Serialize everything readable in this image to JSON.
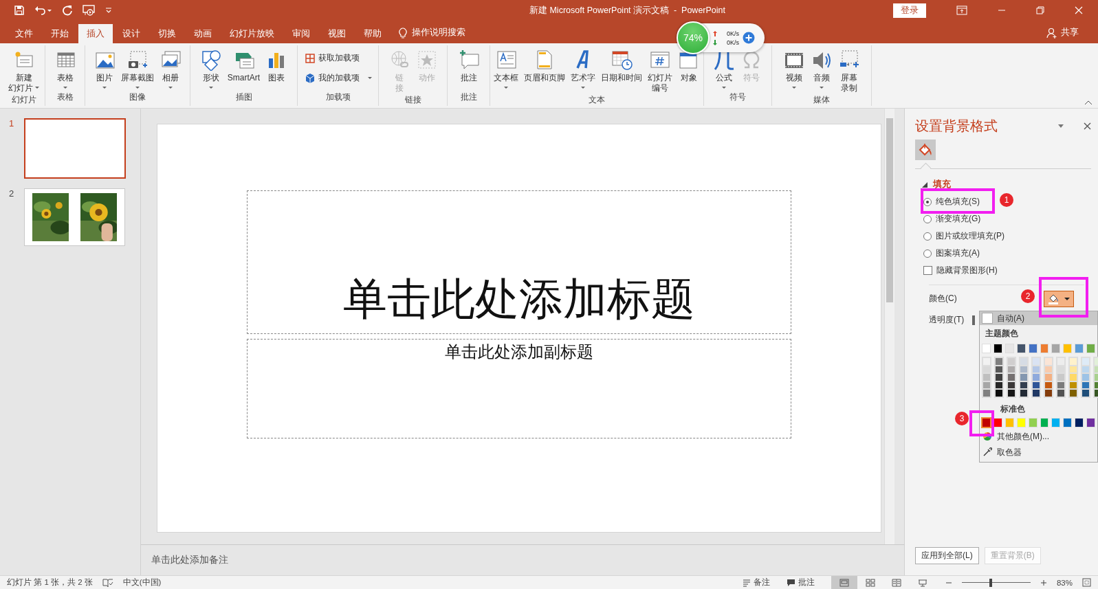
{
  "window": {
    "title": "新建 Microsoft PowerPoint 演示文稿  -  PowerPoint",
    "signin": "登录"
  },
  "tabs": [
    {
      "label": "文件",
      "selected": false
    },
    {
      "label": "开始",
      "selected": false
    },
    {
      "label": "插入",
      "selected": true
    },
    {
      "label": "设计",
      "selected": false
    },
    {
      "label": "切换",
      "selected": false
    },
    {
      "label": "动画",
      "selected": false
    },
    {
      "label": "幻灯片放映",
      "selected": false
    },
    {
      "label": "审阅",
      "selected": false
    },
    {
      "label": "视图",
      "selected": false
    },
    {
      "label": "帮助",
      "selected": false
    }
  ],
  "tell_me": "操作说明搜索",
  "share": "共享",
  "ribbon": {
    "groups": [
      {
        "label": "幻灯片",
        "items": [
          {
            "lines": [
              "新建",
              "幻灯片"
            ],
            "kind": "large",
            "dropdown": true,
            "disabled": false
          }
        ]
      },
      {
        "label": "表格",
        "items": [
          {
            "label": "表格",
            "kind": "large",
            "dropdown": true,
            "disabled": false
          }
        ]
      },
      {
        "label": "图像",
        "items": [
          {
            "label": "图片",
            "kind": "large",
            "dropdown": true,
            "disabled": false
          },
          {
            "label": "屏幕截图",
            "kind": "large",
            "dropdown": true,
            "disabled": false
          },
          {
            "label": "相册",
            "kind": "large",
            "dropdown": true,
            "disabled": false
          }
        ]
      },
      {
        "label": "插图",
        "items": [
          {
            "label": "形状",
            "kind": "large",
            "dropdown": true,
            "disabled": false
          },
          {
            "label": "SmartArt",
            "kind": "large",
            "dropdown": false,
            "disabled": false
          },
          {
            "label": "图表",
            "kind": "large",
            "dropdown": false,
            "disabled": false
          }
        ]
      },
      {
        "label": "加载项",
        "items": [
          {
            "label": "获取加载项",
            "kind": "small",
            "dropdown": false,
            "disabled": false
          },
          {
            "label": "我的加载项",
            "kind": "small",
            "dropdown": true,
            "disabled": false
          }
        ]
      },
      {
        "label": "链接",
        "items": [
          {
            "lines": [
              "链",
              "接"
            ],
            "kind": "large",
            "dropdown": false,
            "disabled": true
          },
          {
            "label": "动作",
            "kind": "large",
            "dropdown": false,
            "disabled": true
          }
        ]
      },
      {
        "label": "批注",
        "items": [
          {
            "label": "批注",
            "kind": "large",
            "dropdown": false,
            "disabled": false
          }
        ]
      },
      {
        "label": "文本",
        "items": [
          {
            "label": "文本框",
            "kind": "large",
            "dropdown": true,
            "disabled": false
          },
          {
            "label": "页眉和页脚",
            "kind": "large",
            "dropdown": false,
            "disabled": false
          },
          {
            "label": "艺术字",
            "kind": "large",
            "dropdown": true,
            "disabled": false
          },
          {
            "label": "日期和时间",
            "kind": "large",
            "dropdown": false,
            "disabled": false
          },
          {
            "lines": [
              "幻灯片",
              "编号"
            ],
            "kind": "large",
            "dropdown": false,
            "disabled": false
          },
          {
            "label": "对象",
            "kind": "large",
            "dropdown": false,
            "disabled": false
          }
        ]
      },
      {
        "label": "符号",
        "items": [
          {
            "label": "公式",
            "kind": "large",
            "dropdown": true,
            "disabled": false
          },
          {
            "label": "符号",
            "kind": "large",
            "dropdown": false,
            "disabled": true
          }
        ]
      },
      {
        "label": "媒体",
        "items": [
          {
            "label": "视频",
            "kind": "large",
            "dropdown": true,
            "disabled": false
          },
          {
            "label": "音频",
            "kind": "large",
            "dropdown": true,
            "disabled": false
          },
          {
            "lines": [
              "屏幕",
              "录制"
            ],
            "kind": "large",
            "dropdown": false,
            "disabled": false
          }
        ]
      }
    ]
  },
  "net_monitor": {
    "percent": "74%",
    "up": "0K/s",
    "down": "0K/s"
  },
  "slides": [
    {
      "number": "1",
      "selected": true
    },
    {
      "number": "2",
      "selected": false
    }
  ],
  "slide": {
    "title": "单击此处添加标题",
    "subtitle": "单击此处添加副标题"
  },
  "notes": "单击此处添加备注",
  "pane": {
    "title": "设置背景格式",
    "section": "填充",
    "expanded": true,
    "fill_options": [
      {
        "label": "纯色填充(S)",
        "selected": true
      },
      {
        "label": "渐变填充(G)",
        "selected": false
      },
      {
        "label": "图片或纹理填充(P)",
        "selected": false
      },
      {
        "label": "图案填充(A)",
        "selected": false
      }
    ],
    "hide_graphics": {
      "label": "隐藏背景图形(H)",
      "checked": false
    },
    "color_label": "颜色(C)",
    "color_button": {
      "color": "#f4b183"
    },
    "transparency_label": "透明度(T)",
    "buttons": [
      {
        "label": "应用到全部(L)",
        "disabled": false
      },
      {
        "label": "重置背景(B)",
        "disabled": true
      }
    ]
  },
  "color_menu": {
    "auto": "自动(A)",
    "theme_label": "主题颜色",
    "theme": [
      {
        "color": "#ffffff",
        "shades": [
          {
            "color": "#f2f2f2"
          },
          {
            "color": "#d9d9d9"
          },
          {
            "color": "#bfbfbf"
          },
          {
            "color": "#a6a6a6"
          },
          {
            "color": "#808080"
          }
        ]
      },
      {
        "color": "#000000",
        "shades": [
          {
            "color": "#808080"
          },
          {
            "color": "#595959"
          },
          {
            "color": "#404040"
          },
          {
            "color": "#262626"
          },
          {
            "color": "#0d0d0d"
          }
        ]
      },
      {
        "color": "#e7e6e6",
        "shades": [
          {
            "color": "#d0cece"
          },
          {
            "color": "#aeabab"
          },
          {
            "color": "#757070"
          },
          {
            "color": "#3b3838"
          },
          {
            "color": "#171616"
          }
        ]
      },
      {
        "color": "#44546a",
        "shades": [
          {
            "color": "#d6dce5"
          },
          {
            "color": "#adb9ca"
          },
          {
            "color": "#8497b0"
          },
          {
            "color": "#333f50"
          },
          {
            "color": "#222a35"
          }
        ]
      },
      {
        "color": "#4472c4",
        "shades": [
          {
            "color": "#dae3f3"
          },
          {
            "color": "#b4c7e7"
          },
          {
            "color": "#8faadc"
          },
          {
            "color": "#2f5597"
          },
          {
            "color": "#203864"
          }
        ]
      },
      {
        "color": "#ed7d31",
        "shades": [
          {
            "color": "#fbe5d6"
          },
          {
            "color": "#f8cbad"
          },
          {
            "color": "#f4b183"
          },
          {
            "color": "#c55a11"
          },
          {
            "color": "#843c0c"
          }
        ]
      },
      {
        "color": "#a5a5a5",
        "shades": [
          {
            "color": "#ededed"
          },
          {
            "color": "#dbdbdb"
          },
          {
            "color": "#c9c9c9"
          },
          {
            "color": "#7b7b7b"
          },
          {
            "color": "#525252"
          }
        ]
      },
      {
        "color": "#ffc000",
        "shades": [
          {
            "color": "#fff2cc"
          },
          {
            "color": "#ffe699"
          },
          {
            "color": "#ffd966"
          },
          {
            "color": "#bf9000"
          },
          {
            "color": "#7f6000"
          }
        ]
      },
      {
        "color": "#5b9bd5",
        "shades": [
          {
            "color": "#deebf7"
          },
          {
            "color": "#bdd7ee"
          },
          {
            "color": "#9dc3e6"
          },
          {
            "color": "#2e75b6"
          },
          {
            "color": "#1f4e79"
          }
        ]
      },
      {
        "color": "#70ad47",
        "shades": [
          {
            "color": "#e2f0d9"
          },
          {
            "color": "#c5e0b4"
          },
          {
            "color": "#a9d18e"
          },
          {
            "color": "#548235"
          },
          {
            "color": "#385723"
          }
        ]
      }
    ],
    "standard_label": "标准色",
    "standard": [
      {
        "color": "#c00000",
        "selected": true
      },
      {
        "color": "#ff0000",
        "selected": false
      },
      {
        "color": "#ffc000",
        "selected": false
      },
      {
        "color": "#ffff00",
        "selected": false
      },
      {
        "color": "#92d050",
        "selected": false
      },
      {
        "color": "#00b050",
        "selected": false
      },
      {
        "color": "#00b0f0",
        "selected": false
      },
      {
        "color": "#0070c0",
        "selected": false
      },
      {
        "color": "#002060",
        "selected": false
      },
      {
        "color": "#7030a0",
        "selected": false
      }
    ],
    "more": "其他颜色(M)...",
    "eyedropper": "取色器"
  },
  "annotations": [
    {
      "number": "1"
    },
    {
      "number": "2"
    },
    {
      "number": "3"
    }
  ],
  "status": {
    "slide_info": "幻灯片 第 1 张，共 2 张",
    "language": "中文(中国)",
    "notes": "备注",
    "comments": "批注",
    "views": [
      {
        "selected": true
      },
      {
        "selected": false
      },
      {
        "selected": false
      },
      {
        "selected": false
      }
    ],
    "zoom": {
      "level": 0.42,
      "reading": "83%"
    }
  }
}
